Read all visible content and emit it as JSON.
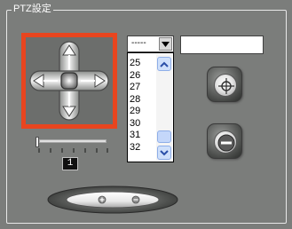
{
  "group": {
    "title": "PTZ設定"
  },
  "preset": {
    "selected_value": "-----",
    "name_value": "",
    "list_items": [
      "25",
      "26",
      "27",
      "28",
      "29",
      "30",
      "31",
      "32"
    ]
  },
  "speed": {
    "value": "1"
  },
  "icons": {
    "joystick": "four-way-arrow-pad",
    "dropdown": "chevron-down-icon",
    "scroll_up": "chevron-up-icon",
    "scroll_down": "chevron-down-icon",
    "set_preset": "crosshair-icon",
    "delete_preset": "minus-circle-icon",
    "zoom": "plus-minus-zoom-icons"
  },
  "colors": {
    "background": "#7b7d7b",
    "joystick_frame": "#e8451f",
    "group_border": "#e8e8e8"
  }
}
